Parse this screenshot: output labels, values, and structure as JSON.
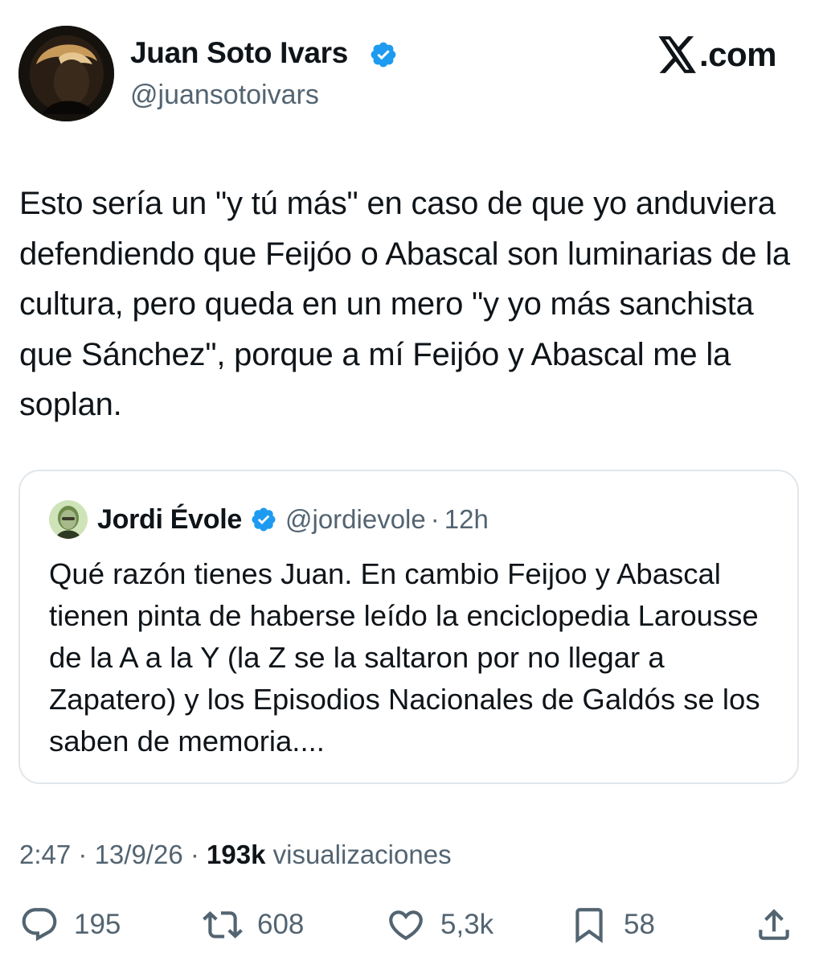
{
  "author": {
    "name": "Juan Soto Ivars",
    "handle": "@juansotoivars",
    "verified": true,
    "avatar_icon": "author-avatar-photo"
  },
  "brand": {
    "label": ".com",
    "icon": "x-logo-icon"
  },
  "tweet": {
    "text": "Esto sería un \"y tú más\" en caso de que yo anduviera defendiendo que Feijóo o Abascal son luminarias de la cultura, pero queda en un mero \"y yo más sanchista que Sánchez\", porque a mí Feijóo y Abascal me la soplan."
  },
  "quote": {
    "name": "Jordi Évole",
    "handle": "@jordievole",
    "separator": "·",
    "time": "12h",
    "verified": true,
    "text": "Qué razón tienes Juan. En cambio Feijoo y Abascal tienen pinta de haberse leído la enciclopedia Larousse de la A a la Y (la Z se la saltaron por no llegar a Zapatero) y los Episodios Nacionales de Galdós se los saben de memoria...."
  },
  "meta": {
    "time": "2:47",
    "sep1": "·",
    "date": "13/9/26",
    "sep2": "·",
    "views_count": "193k",
    "views_label": "visualizaciones"
  },
  "actions": {
    "replies": "195",
    "reposts": "608",
    "likes": "5,3k",
    "bookmarks": "58"
  },
  "colors": {
    "text": "#0f1419",
    "secondary": "#536471",
    "verified_blue": "#1d9bf0",
    "border": "#e1e6ea"
  }
}
